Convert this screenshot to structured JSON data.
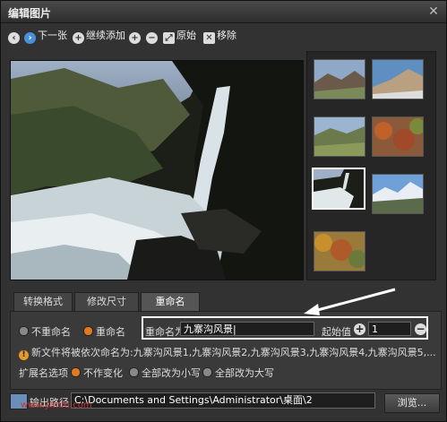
{
  "window": {
    "title": "编辑图片"
  },
  "toolbar": {
    "prev_label": "",
    "next_label": "下一张",
    "add_label": "继续添加",
    "original_label": "原始",
    "remove_label": "移除"
  },
  "tabs": [
    {
      "label": "转换格式"
    },
    {
      "label": "修改尺寸"
    },
    {
      "label": "重命名"
    }
  ],
  "rename": {
    "no_rename_label": "不重命名",
    "rename_label": "重命名",
    "rename_as_label": "重命名为",
    "rename_value": "九寨沟风景|",
    "start_label": "起始值",
    "start_value": "1",
    "preview_text": "新文件将被依次命名为:九寨沟风景1,九寨沟风景2,九寨沟风景3,九寨沟风景4,九寨沟风景5,..."
  },
  "extension": {
    "label": "扩展名选项",
    "opt_nochange": "不作变化",
    "opt_lower": "全部改为小写",
    "opt_upper": "全部改为大写"
  },
  "output": {
    "label": "输出路径",
    "path": "C:\\Documents and Settings\\Administrator\\桌面\\2",
    "browse_label": "浏览...",
    "watermark": "www.ylmfu.com"
  },
  "colors": {
    "accent": "#e07a1f",
    "highlight": "#ffffff"
  }
}
